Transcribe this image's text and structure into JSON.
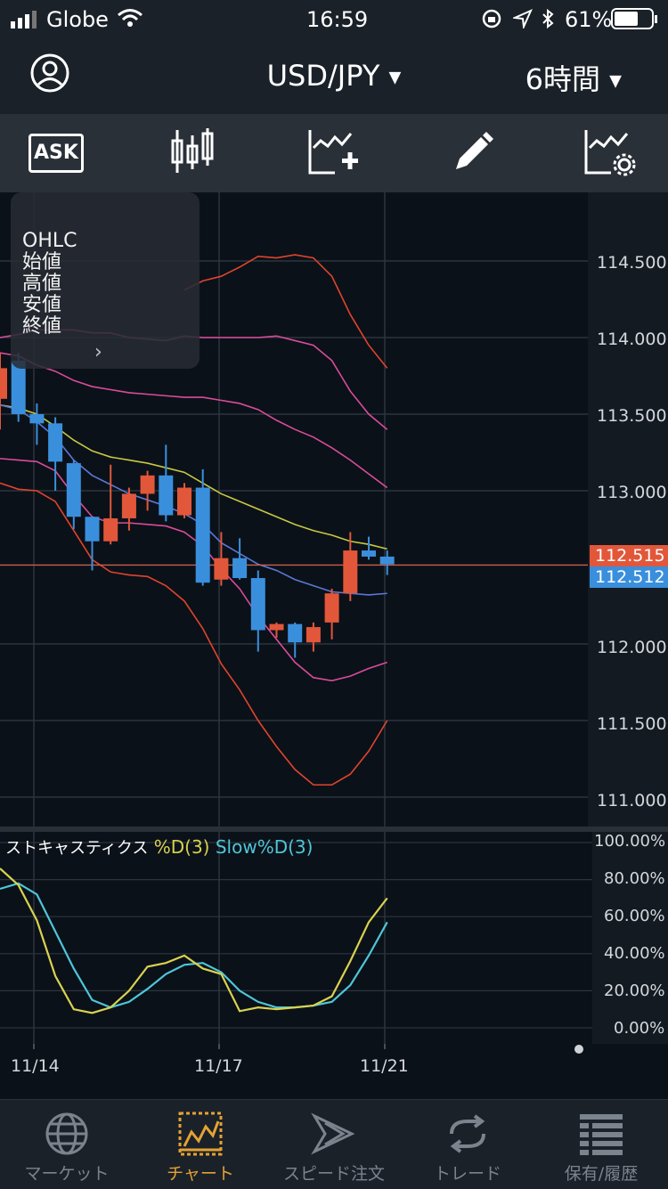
{
  "status_bar": {
    "carrier": "Globe",
    "time": "16:59",
    "battery": "61%"
  },
  "header": {
    "pair": "USD/JPY",
    "timeframe": "6時間",
    "icons": [
      "account-icon",
      "chevron-down-icon"
    ]
  },
  "toolbar": {
    "ask_label": "ASK",
    "buttons": [
      "ask-icon",
      "candlestick-icon",
      "add-indicator-icon",
      "draw-pencil-icon",
      "indicator-settings-icon"
    ]
  },
  "ohlc_panel": {
    "title": "OHLC",
    "open": "始値",
    "high": "高値",
    "low": "安値",
    "close": "終値"
  },
  "price_axis": {
    "ticks": [
      "114.500",
      "114.000",
      "113.500",
      "113.000",
      "112.515",
      "112.512",
      "112.000",
      "111.500",
      "111.000"
    ],
    "ask_price": "112.515",
    "bid_price": "112.512",
    "ask_color": "#e2573a",
    "bid_color": "#3a8fdc"
  },
  "stochastic": {
    "name": "ストキャスティクス",
    "series_d": "%D(3)",
    "series_slow": "Slow%D(3)",
    "d_color": "#d9d24e",
    "slow_color": "#4ec6d8",
    "ticks": [
      "100.00%",
      "80.00%",
      "60.00%",
      "40.00%",
      "20.00%",
      "0.00%"
    ],
    "d_values": [
      86,
      77,
      58,
      28,
      10,
      8,
      11,
      20,
      33,
      35,
      39,
      32,
      29,
      9,
      11,
      10,
      11,
      12,
      17,
      36,
      57,
      70
    ],
    "slow_values": [
      75,
      78,
      72,
      52,
      32,
      15,
      11,
      14,
      21,
      29,
      34,
      35,
      30,
      20,
      14,
      11,
      11,
      12,
      14,
      23,
      39,
      57
    ]
  },
  "time_axis": {
    "labels": [
      "11/14",
      "11/17",
      "11/21"
    ]
  },
  "chart_data": {
    "type": "candlestick",
    "ylim": [
      110.9,
      114.85
    ],
    "up_color": "#e2573a",
    "down_color": "#3a8fdc",
    "candles": [
      {
        "o": 113.6,
        "h": 113.9,
        "l": 113.4,
        "c": 113.8
      },
      {
        "o": 113.85,
        "h": 113.9,
        "l": 113.45,
        "c": 113.5
      },
      {
        "o": 113.5,
        "h": 113.57,
        "l": 113.3,
        "c": 113.44
      },
      {
        "o": 113.44,
        "h": 113.48,
        "l": 113.0,
        "c": 113.19
      },
      {
        "o": 113.18,
        "h": 113.2,
        "l": 112.75,
        "c": 112.83
      },
      {
        "o": 112.83,
        "h": 112.83,
        "l": 112.48,
        "c": 112.67
      },
      {
        "o": 112.67,
        "h": 113.17,
        "l": 112.65,
        "c": 112.82
      },
      {
        "o": 112.82,
        "h": 113.02,
        "l": 112.74,
        "c": 112.98
      },
      {
        "o": 112.98,
        "h": 113.13,
        "l": 112.87,
        "c": 113.1
      },
      {
        "o": 113.1,
        "h": 113.3,
        "l": 112.8,
        "c": 112.84
      },
      {
        "o": 112.84,
        "h": 113.05,
        "l": 112.82,
        "c": 113.02
      },
      {
        "o": 113.02,
        "h": 113.14,
        "l": 112.38,
        "c": 112.4
      },
      {
        "o": 112.42,
        "h": 112.73,
        "l": 112.38,
        "c": 112.56
      },
      {
        "o": 112.56,
        "h": 112.69,
        "l": 112.42,
        "c": 112.43
      },
      {
        "o": 112.43,
        "h": 112.48,
        "l": 111.95,
        "c": 112.09
      },
      {
        "o": 112.09,
        "h": 112.14,
        "l": 112.04,
        "c": 112.13
      },
      {
        "o": 112.13,
        "h": 112.14,
        "l": 111.91,
        "c": 112.01
      },
      {
        "o": 112.01,
        "h": 112.14,
        "l": 111.95,
        "c": 112.11
      },
      {
        "o": 112.14,
        "h": 112.36,
        "l": 112.03,
        "c": 112.33
      },
      {
        "o": 112.33,
        "h": 112.73,
        "l": 112.28,
        "c": 112.61
      },
      {
        "o": 112.61,
        "h": 112.7,
        "l": 112.55,
        "c": 112.57
      },
      {
        "o": 112.57,
        "h": 112.61,
        "l": 112.45,
        "c": 112.52
      }
    ],
    "bands": [
      {
        "name": "upper2",
        "color": "#e0442c",
        "values": [
          null,
          null,
          null,
          null,
          null,
          null,
          null,
          null,
          null,
          null,
          114.31,
          114.37,
          114.4,
          114.46,
          114.53,
          114.52,
          114.54,
          114.52,
          114.4,
          114.15,
          113.95,
          113.8
        ]
      },
      {
        "name": "upper1",
        "color": "#d94c9a",
        "values": [
          114.0,
          114.02,
          114.05,
          114.05,
          114.05,
          114.03,
          114.03,
          114.0,
          113.99,
          113.98,
          114.01,
          114.0,
          114.0,
          114.0,
          114.0,
          114.01,
          113.98,
          113.95,
          113.85,
          113.65,
          113.5,
          113.4
        ]
      },
      {
        "name": "ma",
        "color": "#d94c9a",
        "values": [
          113.9,
          113.88,
          113.82,
          113.78,
          113.72,
          113.68,
          113.66,
          113.64,
          113.63,
          113.62,
          113.61,
          113.61,
          113.59,
          113.57,
          113.53,
          113.46,
          113.4,
          113.35,
          113.28,
          113.2,
          113.11,
          113.02
        ]
      },
      {
        "name": "sma-yellow",
        "color": "#c8c842",
        "values": [
          113.56,
          113.54,
          113.5,
          113.42,
          113.33,
          113.26,
          113.22,
          113.2,
          113.18,
          113.15,
          113.12,
          113.05,
          112.98,
          112.93,
          112.88,
          112.83,
          112.78,
          112.74,
          112.71,
          112.67,
          112.65,
          112.62
        ]
      },
      {
        "name": "sma-blue",
        "color": "#5b78d8",
        "values": [
          113.56,
          113.53,
          113.45,
          113.35,
          113.2,
          113.1,
          113.04,
          112.98,
          112.94,
          112.9,
          112.85,
          112.78,
          112.66,
          112.59,
          112.52,
          112.48,
          112.42,
          112.38,
          112.34,
          112.33,
          112.32,
          112.33
        ]
      },
      {
        "name": "lower1",
        "color": "#d94c9a",
        "values": [
          113.21,
          113.2,
          113.19,
          113.13,
          112.97,
          112.83,
          112.79,
          112.79,
          112.78,
          112.77,
          112.73,
          112.64,
          112.49,
          112.36,
          112.18,
          112.03,
          111.88,
          111.78,
          111.76,
          111.79,
          111.84,
          111.88
        ]
      },
      {
        "name": "lower2",
        "color": "#e0442c",
        "values": [
          113.05,
          113.01,
          113.0,
          112.93,
          112.74,
          112.55,
          112.47,
          112.45,
          112.44,
          112.38,
          112.28,
          112.1,
          111.87,
          111.7,
          111.5,
          111.33,
          111.18,
          111.08,
          111.08,
          111.15,
          111.3,
          111.5
        ]
      }
    ]
  },
  "bottom_nav": {
    "items": [
      {
        "label": "マーケット",
        "icon": "globe-icon"
      },
      {
        "label": "チャート",
        "icon": "chart-icon"
      },
      {
        "label": "スピード注文",
        "icon": "speed-order-icon"
      },
      {
        "label": "トレード",
        "icon": "trade-icon"
      },
      {
        "label": "保有/履歴",
        "icon": "history-icon"
      }
    ],
    "active_index": 1,
    "active_color": "#e4a234"
  }
}
